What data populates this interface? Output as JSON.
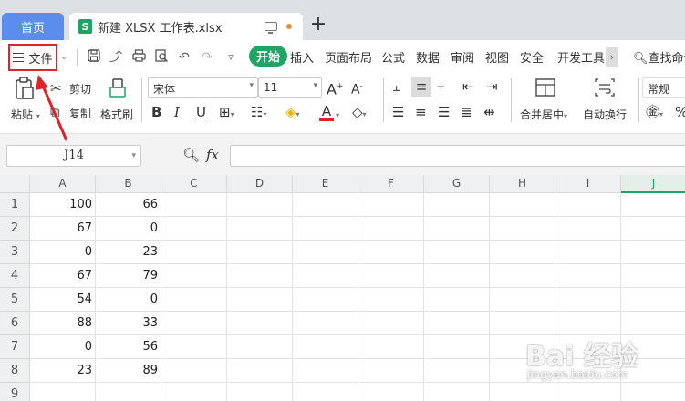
{
  "tabs": {
    "home": "首页",
    "doc_icon": "S",
    "doc_title": "新建 XLSX 工作表.xlsx",
    "new_tab": "+"
  },
  "menubar": {
    "file": "文件",
    "tabs": [
      "开始",
      "插入",
      "页面布局",
      "公式",
      "数据",
      "审阅",
      "视图",
      "安全",
      "开发工具"
    ],
    "search": "查找命令"
  },
  "ribbon": {
    "paste": "粘贴",
    "cut": "剪切",
    "copy": "复制",
    "format_painter": "格式刷",
    "font_name": "宋体",
    "font_size": "11",
    "merge_center": "合并居中",
    "wrap_text": "自动换行",
    "number_format": "常规"
  },
  "formula_bar": {
    "name_box": "J14",
    "fx": "fx",
    "value": ""
  },
  "grid": {
    "columns": [
      "A",
      "B",
      "C",
      "D",
      "E",
      "F",
      "G",
      "H",
      "I",
      "J"
    ],
    "selected_column": "J",
    "rows": [
      {
        "n": "1",
        "a": "100",
        "b": "66"
      },
      {
        "n": "2",
        "a": "67",
        "b": "0"
      },
      {
        "n": "3",
        "a": "0",
        "b": "23"
      },
      {
        "n": "4",
        "a": "67",
        "b": "79"
      },
      {
        "n": "5",
        "a": "54",
        "b": "0"
      },
      {
        "n": "6",
        "a": "88",
        "b": "33"
      },
      {
        "n": "7",
        "a": "0",
        "b": "56"
      },
      {
        "n": "8",
        "a": "23",
        "b": "89"
      },
      {
        "n": "9",
        "a": "",
        "b": ""
      }
    ]
  },
  "watermark": {
    "brand": "Bai 经验",
    "url": "jingyan.baidu.com"
  },
  "colors": {
    "accent": "#1fa463",
    "home_tab": "#5b8def",
    "highlight": "#e0222a"
  }
}
